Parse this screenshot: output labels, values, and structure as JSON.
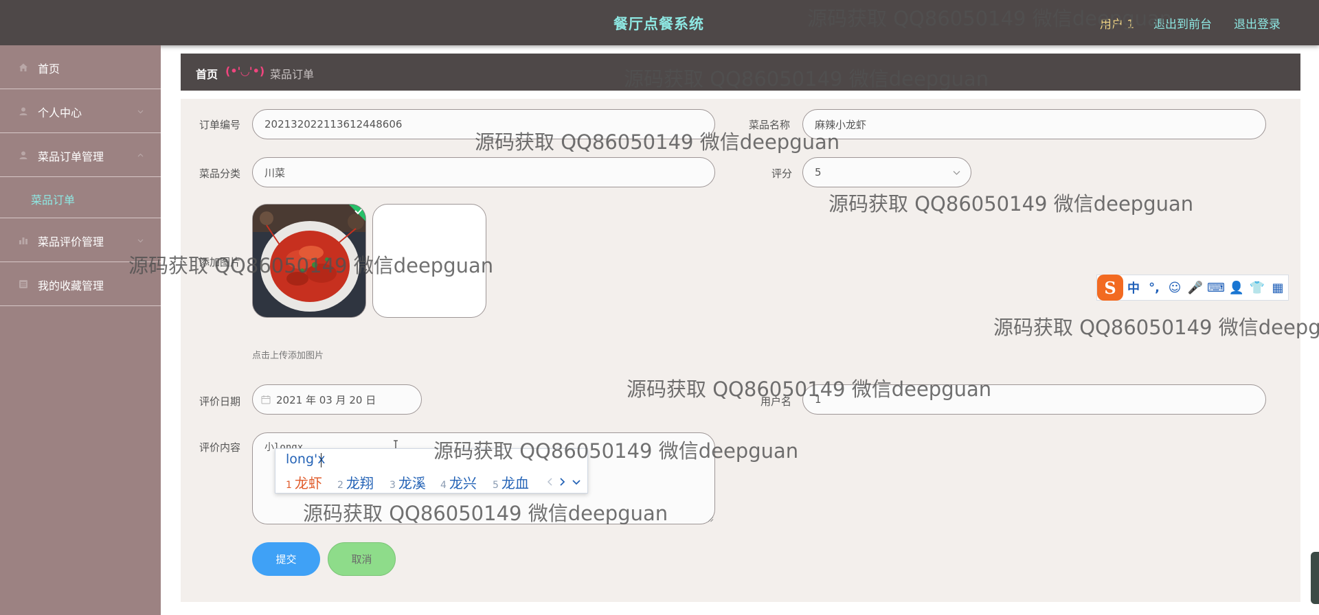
{
  "header": {
    "app_title": "餐厅点餐系统",
    "user_label": "用户 1",
    "links": [
      "退出到前台",
      "退出登录"
    ]
  },
  "sidebar": {
    "items": [
      {
        "label": "首页",
        "icon": "home-icon"
      },
      {
        "label": "个人中心",
        "icon": "user-icon"
      },
      {
        "label": "菜品订单管理",
        "icon": "user-icon"
      },
      {
        "label": "菜品订单",
        "icon": ""
      },
      {
        "label": "菜品评价管理",
        "icon": "bar-chart-icon"
      },
      {
        "label": "我的收藏管理",
        "icon": "list-icon"
      }
    ]
  },
  "breadcrumb": {
    "home": "首页",
    "separator": "(•'◡'•)",
    "current": "菜品订单"
  },
  "form": {
    "order_no_label": "订单编号",
    "order_no_value": "202132022113612448606",
    "dish_name_label": "菜品名称",
    "dish_name_value": "麻辣小龙虾",
    "category_label": "菜品分类",
    "category_value": "川菜",
    "rating_label": "评分",
    "rating_value": "5",
    "image_label": "添加图片",
    "upload_hint": "点击上传添加图片",
    "eval_date_label": "评价日期",
    "eval_date_value": "2021 年 03 月 20 日",
    "username_label": "用户名",
    "username_value": "1",
    "content_label": "评价内容",
    "content_value": "小longx",
    "submit": "提交",
    "cancel": "取消"
  },
  "ime": {
    "composition": "long'x",
    "candidates": [
      {
        "num": "1",
        "text": "龙虾"
      },
      {
        "num": "2",
        "text": "龙翔"
      },
      {
        "num": "3",
        "text": "龙溪"
      },
      {
        "num": "4",
        "text": "龙兴"
      },
      {
        "num": "5",
        "text": "龙血"
      }
    ],
    "toolbar_logo": "S",
    "toolbar_items": [
      "中",
      "°,",
      "☺",
      "🎤",
      "⌨",
      "👤",
      "👕",
      "▦"
    ]
  },
  "watermark": "源码获取 QQ86050149 微信deepguan",
  "colors": {
    "header_bg": "#4e4848",
    "sidebar_bg": "#9c8282",
    "accent_cyan": "#8ee8e3",
    "submit_blue": "#3fa1f6",
    "cancel_green": "#8edc8a"
  }
}
